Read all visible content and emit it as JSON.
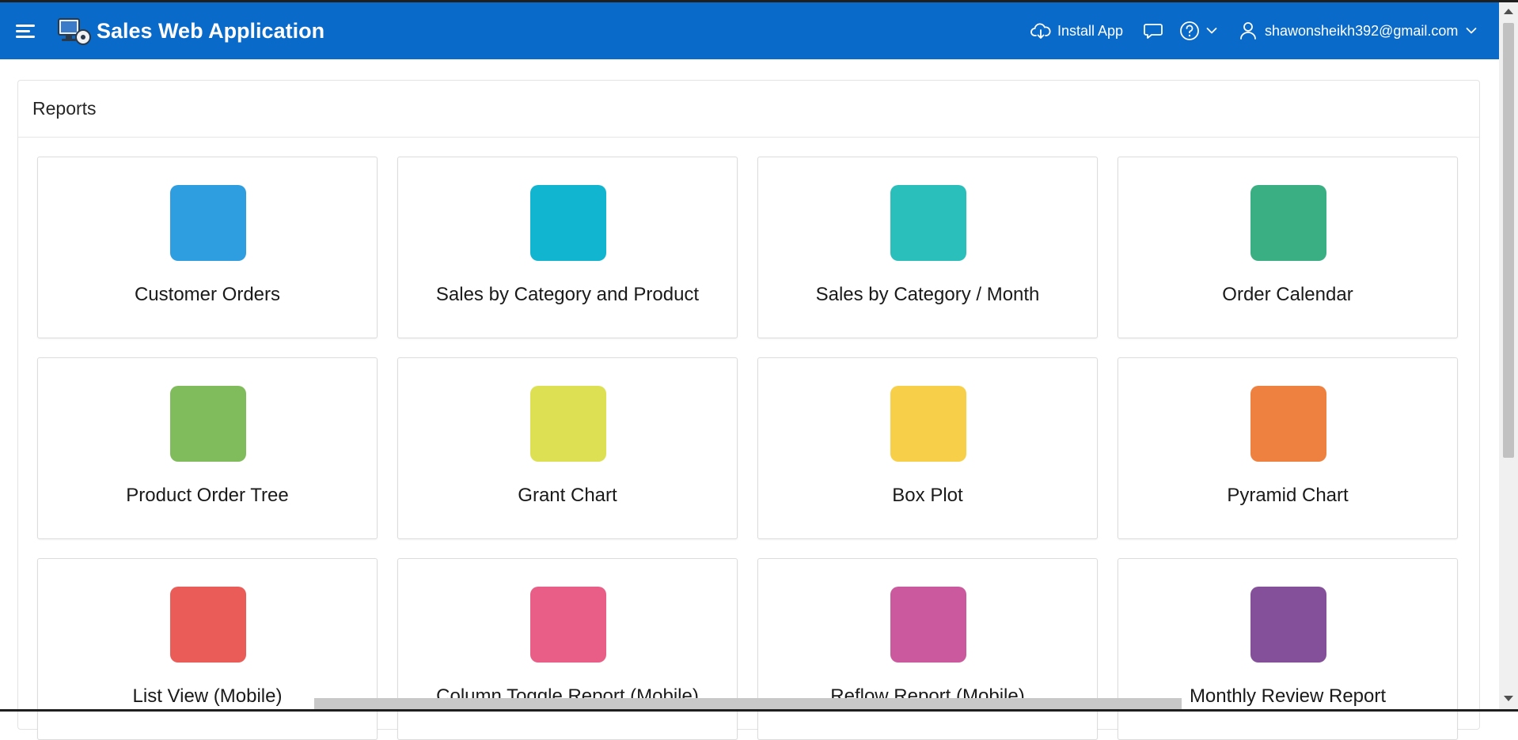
{
  "header": {
    "app_title": "Sales Web Application",
    "install_label": "Install App",
    "user_email": "shawonsheikh392@gmail.com",
    "background_color": "#0a6ac9"
  },
  "icons": {
    "menu": "hamburger-menu-icon",
    "logo": "computer-logo-icon",
    "install": "cloud-download-icon",
    "chat": "chat-bubble-icon",
    "help": "question-circle-icon",
    "user": "user-icon",
    "dropdown": "chevron-down-icon"
  },
  "region": {
    "title": "Reports"
  },
  "cards": [
    {
      "label": "Customer Orders",
      "color": "#2e9ee0"
    },
    {
      "label": "Sales by Category and Product",
      "color": "#12b5d0"
    },
    {
      "label": "Sales by Category / Month",
      "color": "#2bbfbc"
    },
    {
      "label": "Order Calendar",
      "color": "#3aaf84"
    },
    {
      "label": "Product Order Tree",
      "color": "#80bc5c"
    },
    {
      "label": "Grant Chart",
      "color": "#dde052"
    },
    {
      "label": "Box Plot",
      "color": "#f8cf48"
    },
    {
      "label": "Pyramid Chart",
      "color": "#ee813f"
    },
    {
      "label": "List View (Mobile)",
      "color": "#e95c57"
    },
    {
      "label": "Column Toggle Report (Mobile)",
      "color": "#e85e86"
    },
    {
      "label": "Reflow Report (Mobile)",
      "color": "#cb599d"
    },
    {
      "label": "Monthly Review Report",
      "color": "#85509a"
    }
  ]
}
